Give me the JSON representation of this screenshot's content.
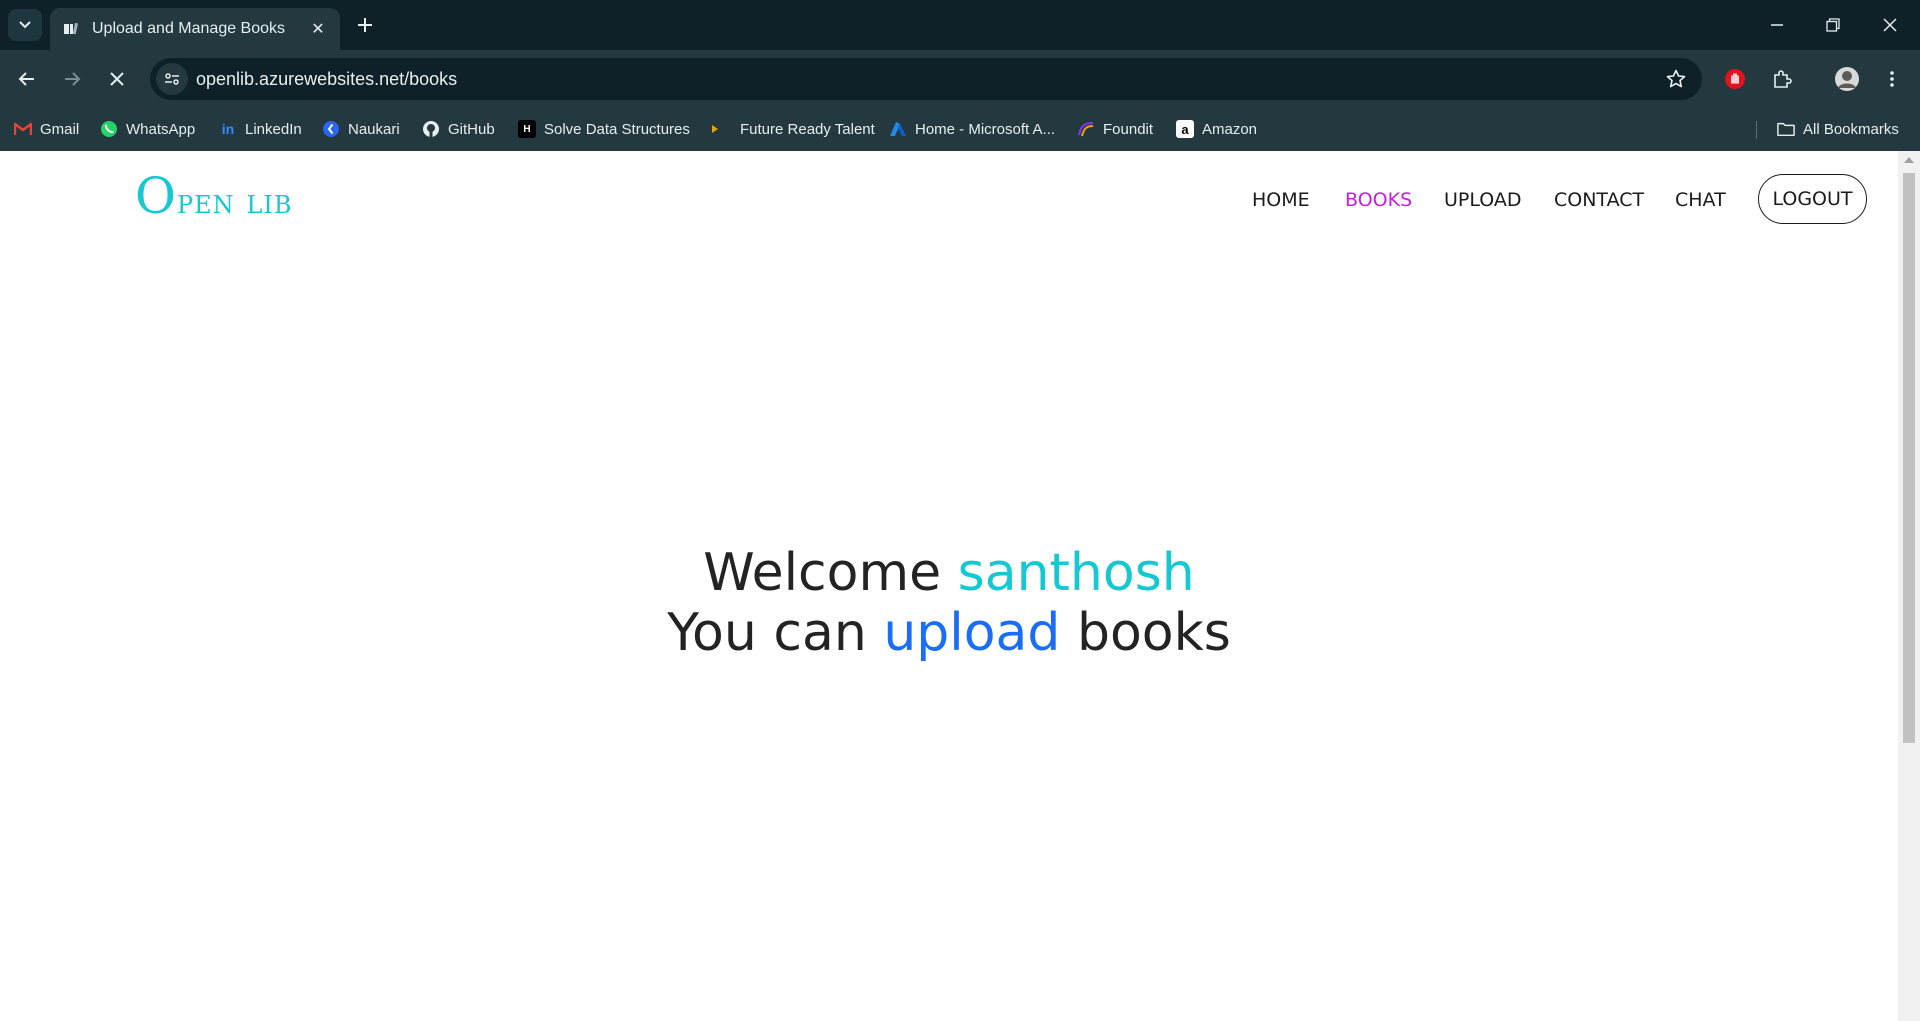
{
  "browser": {
    "tab_title": "Upload and Manage Books",
    "url": "openlib.azurewebsites.net/books",
    "bookmarks": [
      {
        "label": "Gmail",
        "icon": "gmail-icon"
      },
      {
        "label": "WhatsApp",
        "icon": "whatsapp-icon"
      },
      {
        "label": "LinkedIn",
        "icon": "linkedin-icon"
      },
      {
        "label": "Naukari",
        "icon": "naukari-icon"
      },
      {
        "label": "GitHub",
        "icon": "github-icon"
      },
      {
        "label": "Solve Data Structures",
        "icon": "hackerrank-icon"
      },
      {
        "label": "Future Ready Talent",
        "icon": "play-icon"
      },
      {
        "label": "Home - Microsoft A...",
        "icon": "azure-icon"
      },
      {
        "label": "Foundit",
        "icon": "foundit-icon"
      },
      {
        "label": "Amazon",
        "icon": "amazon-icon"
      }
    ],
    "all_bookmarks_label": "All Bookmarks"
  },
  "site": {
    "logo_initial": "O",
    "logo_rest": "pen lib",
    "nav": {
      "home": "HOME",
      "books": "BOOKS",
      "upload": "UPLOAD",
      "contact": "CONTACT",
      "chat": "CHAT",
      "logout": "LOGOUT"
    },
    "active_nav": "BOOKS"
  },
  "hero": {
    "welcome": "Welcome",
    "username": "santhosh",
    "line2_prefix": "You can",
    "line2_highlight": "upload",
    "line2_suffix": "books"
  },
  "colors": {
    "brand_cyan": "#16c8d1",
    "active_nav": "#c61fdc",
    "highlight_blue": "#1a6ef5",
    "chrome_dark": "#0e2128",
    "chrome_toolbar": "#23383f"
  }
}
